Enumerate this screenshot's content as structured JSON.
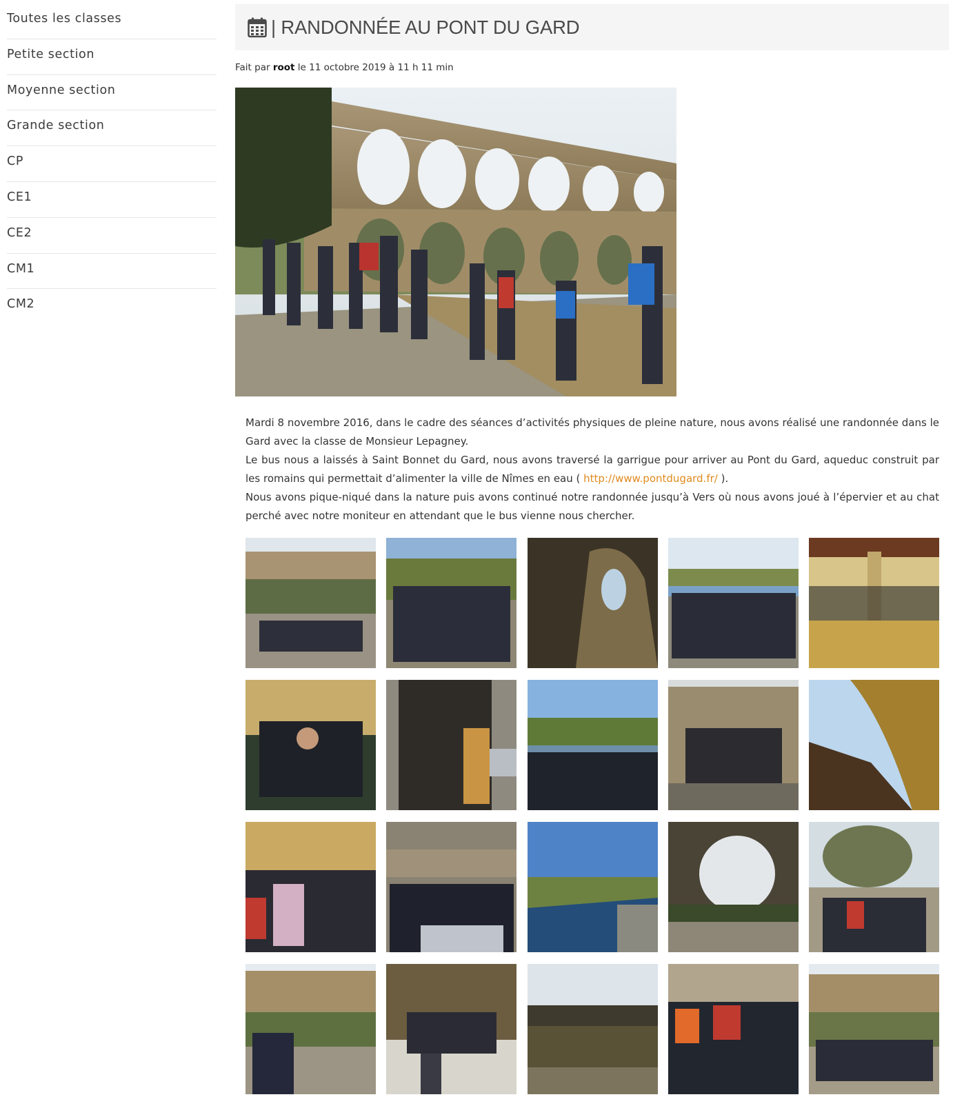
{
  "sidebar": {
    "items": [
      {
        "label": "Toutes les classes"
      },
      {
        "label": "Petite section"
      },
      {
        "label": "Moyenne section"
      },
      {
        "label": "Grande section"
      },
      {
        "label": "CP"
      },
      {
        "label": "CE1"
      },
      {
        "label": "CE2"
      },
      {
        "label": "CM1"
      },
      {
        "label": "CM2"
      }
    ]
  },
  "post": {
    "icon": "calendar-icon",
    "title": "| RANDONNÉE AU PONT DU GARD",
    "meta_prefix": "Fait par ",
    "meta_author": "root",
    "meta_suffix": " le 11 octobre 2019 à 11 h 11 min",
    "paragraphs": {
      "p1": "Mardi 8 novembre 2016, dans le cadre des séances d’activités physiques de pleine nature, nous avons réalisé une randonnée dans le Gard avec la classe de Monsieur Lepagney.",
      "p2_before": "Le bus nous a laissés à Saint Bonnet du Gard, nous avons traversé la garrigue pour arriver au Pont du Gard, aqueduc construit par les romains qui permettait d’alimenter la ville de Nîmes en eau ( ",
      "p2_link": "http://www.pontdugard.fr/",
      "p2_after": " ).",
      "p3": "Nous avons pique-niqué dans la nature puis avons continué notre randonnée jusqu’à Vers où nous avons joué à l’épervier et au chat perché avec notre moniteur en attendant que le bus vienne nous chercher."
    }
  },
  "colors": {
    "link": "#e08a1e",
    "header_bg": "#f5f5f5"
  }
}
